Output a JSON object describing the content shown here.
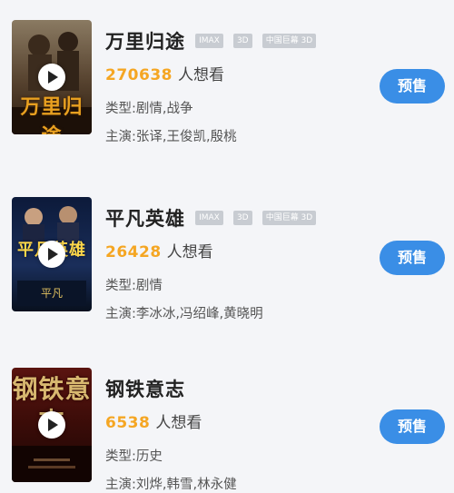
{
  "movies": [
    {
      "title": "万里归途",
      "badges": [
        "IMAX",
        "3D",
        "中国巨幕 3D"
      ],
      "want_count": "270638",
      "want_label": "人想看",
      "genre": "类型:剧情,战争",
      "cast": "主演:张译,王俊凯,殷桃",
      "presale_label": "预售",
      "poster_title": "万里归途",
      "play_icon": "play-icon"
    },
    {
      "title": "平凡英雄",
      "badges": [
        "IMAX",
        "3D",
        "中国巨幕 3D"
      ],
      "want_count": "26428",
      "want_label": "人想看",
      "genre": "类型:剧情",
      "cast": "主演:李冰冰,冯绍峰,黄晓明",
      "presale_label": "预售",
      "poster_title": "平凡英雄",
      "play_icon": "play-icon"
    },
    {
      "title": "钢铁意志",
      "badges": [],
      "want_count": "6538",
      "want_label": "人想看",
      "genre": "类型:历史",
      "cast": "主演:刘烨,韩雪,林永健",
      "presale_label": "预售",
      "poster_title": "钢铁意志",
      "play_icon": "play-icon"
    }
  ],
  "colors": {
    "accent": "#3a8ee6",
    "want_count": "#f5a623",
    "badge": "#c8ccd2",
    "background": "#f4f5f8"
  }
}
